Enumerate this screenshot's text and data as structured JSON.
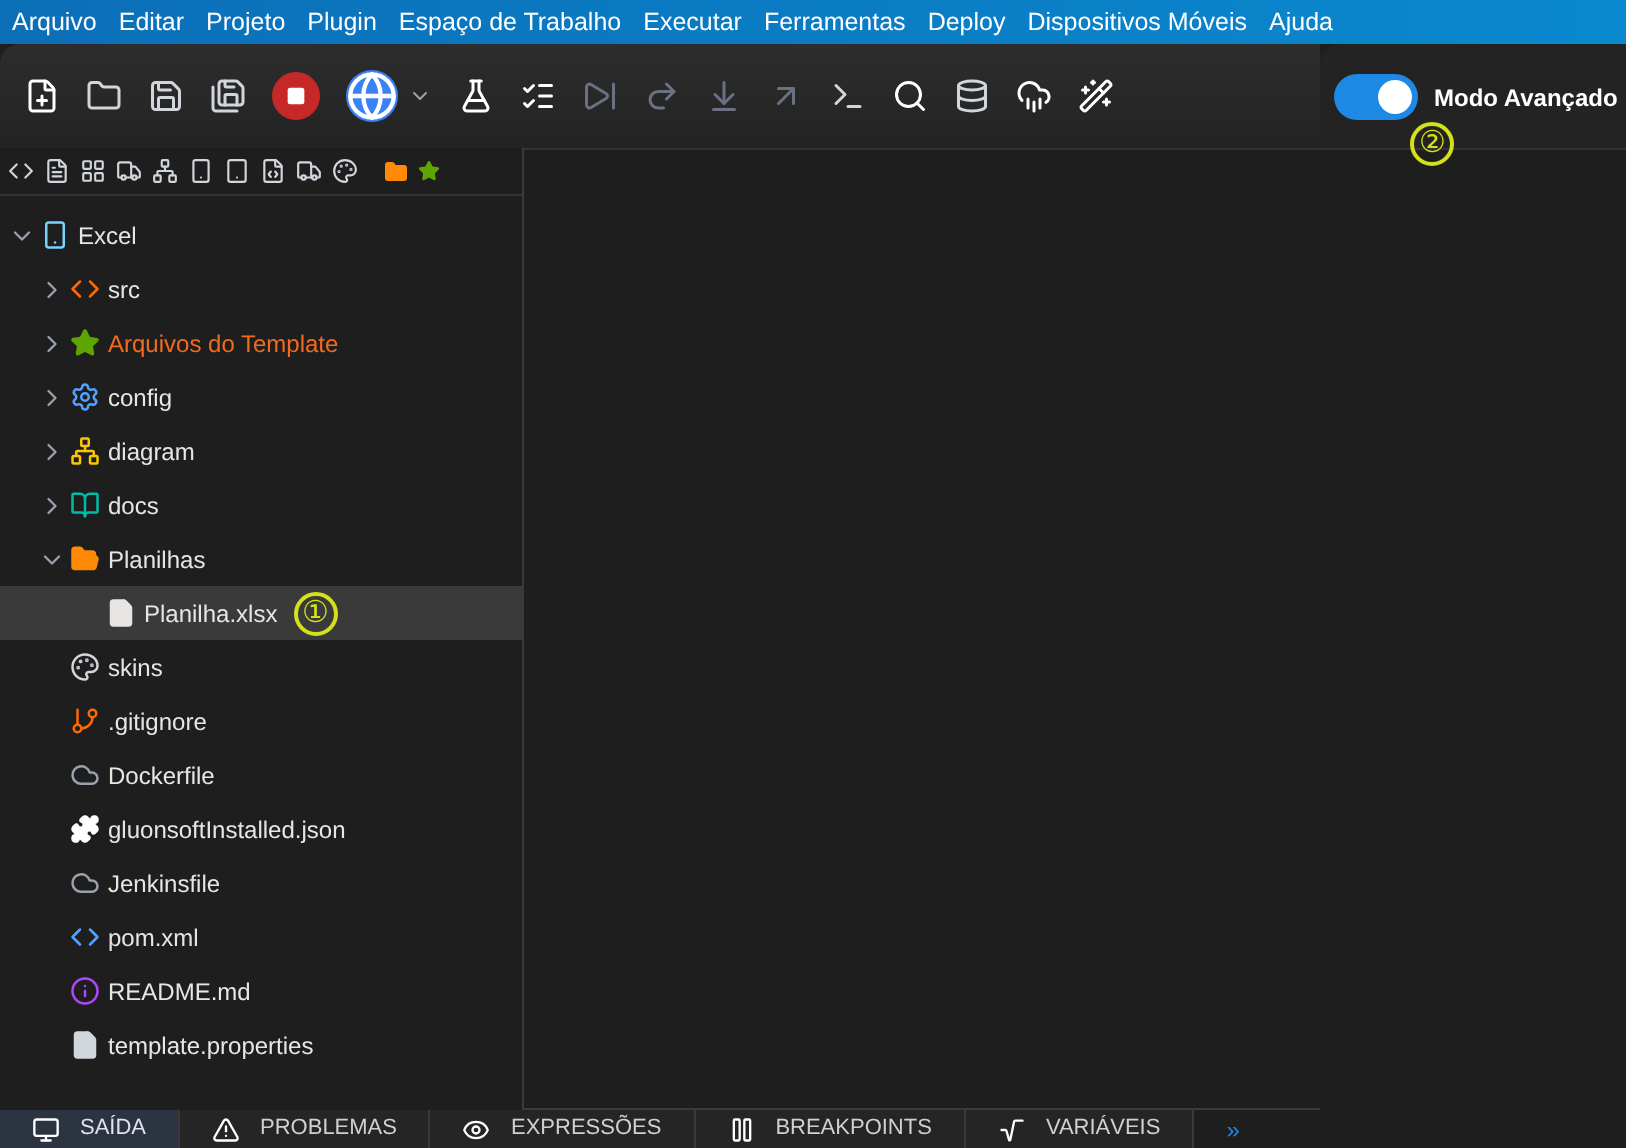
{
  "menu": [
    "Arquivo",
    "Editar",
    "Projeto",
    "Plugin",
    "Espaço de Trabalho",
    "Executar",
    "Ferramentas",
    "Deploy",
    "Dispositivos Móveis",
    "Ajuda"
  ],
  "advanced_mode": {
    "label": "Modo Avançado",
    "on": true,
    "callout": "②"
  },
  "tree": {
    "label": "Excel",
    "kind": "project",
    "expanded": true,
    "selected": false,
    "children": [
      {
        "label": "src",
        "kind": "src",
        "expanded": false,
        "selected": false
      },
      {
        "label": "Arquivos do Template",
        "kind": "template",
        "expanded": false,
        "selected": false
      },
      {
        "label": "config",
        "kind": "config",
        "expanded": false,
        "selected": false
      },
      {
        "label": "diagram",
        "kind": "diagram",
        "expanded": false,
        "selected": false
      },
      {
        "label": "docs",
        "kind": "docs",
        "expanded": false,
        "selected": false
      },
      {
        "label": "Planilhas",
        "kind": "folder",
        "expanded": true,
        "selected": false,
        "children": [
          {
            "label": "Planilha.xlsx",
            "kind": "file",
            "selected": true,
            "callout": "①"
          }
        ]
      },
      {
        "label": "skins",
        "kind": "skins",
        "selected": false
      },
      {
        "label": ".gitignore",
        "kind": "git",
        "selected": false
      },
      {
        "label": "Dockerfile",
        "kind": "cloud",
        "selected": false
      },
      {
        "label": "gluonsoftInstalled.json",
        "kind": "plugin",
        "selected": false
      },
      {
        "label": "Jenkinsfile",
        "kind": "cloud",
        "selected": false
      },
      {
        "label": "pom.xml",
        "kind": "code",
        "selected": false
      },
      {
        "label": "README.md",
        "kind": "info",
        "selected": false
      },
      {
        "label": "template.properties",
        "kind": "props",
        "selected": false
      }
    ]
  },
  "bottom_tabs": [
    {
      "label": "SAÍDA",
      "kind": "output",
      "selected": true
    },
    {
      "label": "PROBLEMAS",
      "kind": "problems",
      "selected": false
    },
    {
      "label": "EXPRESSÕES",
      "kind": "expressions",
      "selected": false
    },
    {
      "label": "BREAKPOINTS",
      "kind": "breakpoints",
      "selected": false
    },
    {
      "label": "VARIÁVEIS",
      "kind": "variables",
      "selected": false
    }
  ],
  "more_tabs": "»"
}
